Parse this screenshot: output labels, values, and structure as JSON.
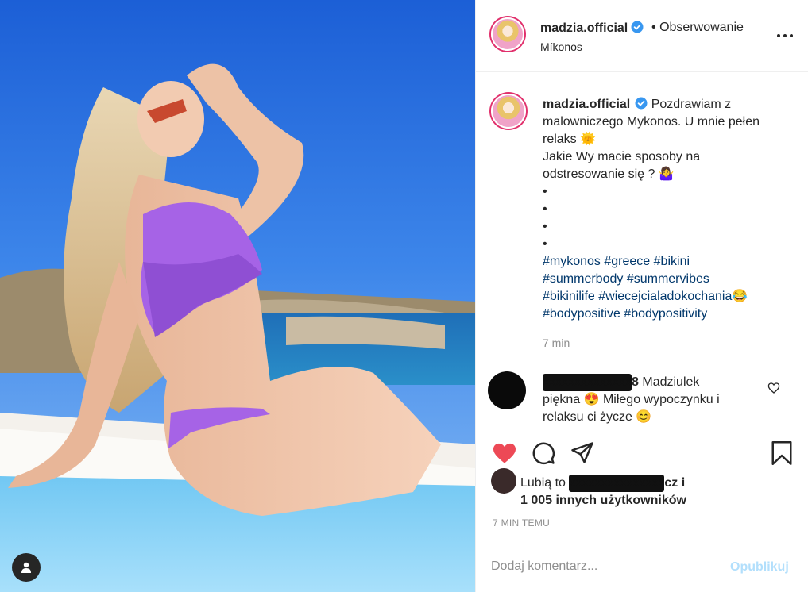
{
  "post": {
    "author": "madzia.official",
    "follow_prefix": "•",
    "follow_label": "Obserwowanie",
    "location": "Míkonos"
  },
  "caption": {
    "author": "madzia.official",
    "lines": [
      "Pozdrawiam z",
      "malowniczego Mykonos. U mnie pełen",
      "relaks 🌞",
      "Jakie Wy macie sposoby na",
      "odstresowanie się ? 🤷‍♀️",
      "•",
      "•",
      "•",
      "•"
    ],
    "hashtags": [
      "#mykonos",
      "#greece",
      "#bikini",
      "#summerbody",
      "#summervibes",
      "#bikinilife",
      "#wiecejcialadokochania😂",
      "#bodypositive",
      "#bodypositivity"
    ],
    "time": "7 min"
  },
  "comment": {
    "user_suffix": "8",
    "text_start": "Madziulek",
    "text_line2": "piękna 😍 Miłego wypoczynku i",
    "text_line3": "relaksu ci życze 😊"
  },
  "likes": {
    "prefix": "Lubią to",
    "suffix": "cz i",
    "count_text": "1 005 innych użytkowników"
  },
  "timestamp": "7 MIN TEMU",
  "composer": {
    "placeholder": "Dodaj komentarz...",
    "publish": "Opublikuj"
  },
  "colors": {
    "like_red": "#ed4956",
    "hashtag": "#00376b",
    "publish_disabled": "#b2dffc",
    "verified": "#3897f0"
  }
}
